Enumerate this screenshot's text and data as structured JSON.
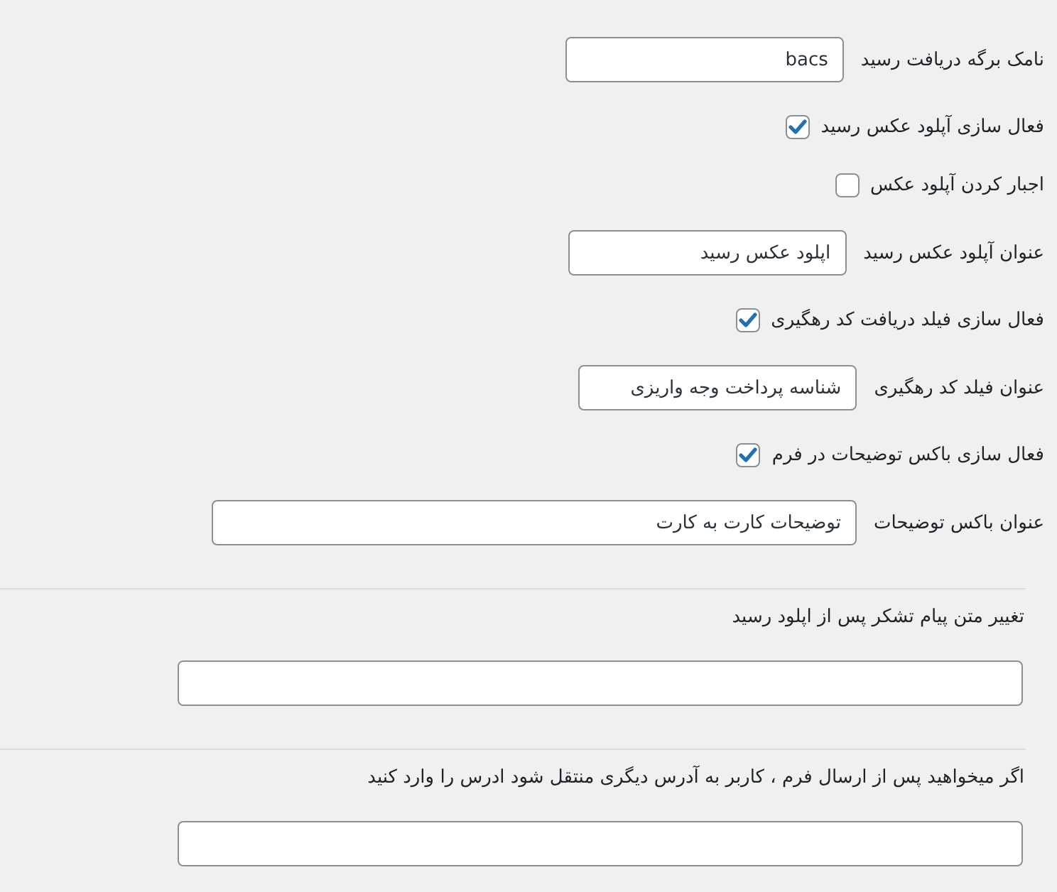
{
  "settings": [
    {
      "kind": "text_field",
      "label": "نامک برگه دریافت رسید",
      "value": "bacs"
    },
    {
      "kind": "checkbox",
      "label": "فعال سازی آپلود عکس رسید",
      "checked": true
    },
    {
      "kind": "checkbox",
      "label": "اجبار کردن آپلود عکس",
      "checked": false
    },
    {
      "kind": "text_field",
      "label": "عنوان آپلود عکس رسید",
      "value": "اپلود عکس رسید"
    },
    {
      "kind": "checkbox",
      "label": "فعال سازی فیلد دریافت کد رهگیری",
      "checked": true
    },
    {
      "kind": "text_field",
      "label": "عنوان فیلد کد رهگیری",
      "value": "شناسه پرداخت وجه واریزی"
    },
    {
      "kind": "checkbox",
      "label": "فعال سازی باکس توضیحات در فرم",
      "checked": true
    },
    {
      "kind": "long_text_field",
      "label": "عنوان باکس توضیحات",
      "value": "توضیحات کارت به کارت"
    }
  ],
  "sections": [
    {
      "label": "تغییر متن پیام تشکر پس از اپلود رسید"
    },
    {
      "label": "اگر میخواهید پس از ارسال فرم ، کاربر به آدرس دیگری منتقل شود ادرس را وارد کنید"
    }
  ]
}
